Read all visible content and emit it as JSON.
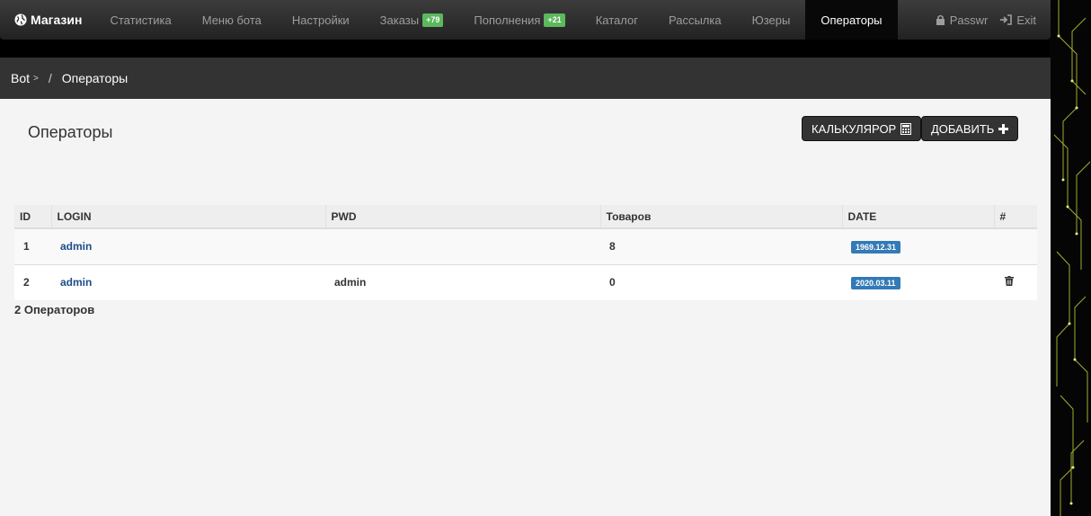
{
  "brand": "Магазин",
  "nav": {
    "items": [
      {
        "label": "Статистика"
      },
      {
        "label": "Меню бота"
      },
      {
        "label": "Настройки"
      },
      {
        "label": "Заказы",
        "badge": "+79"
      },
      {
        "label": "Пополнения",
        "badge": "+21"
      },
      {
        "label": "Каталог"
      },
      {
        "label": "Рассылка"
      },
      {
        "label": "Юзеры"
      },
      {
        "label": "Операторы",
        "active": true
      }
    ],
    "passwr": "Passwr",
    "exit": "Exit"
  },
  "breadcrumb": {
    "root": "Bot",
    "root_sep": ">",
    "slash": "/",
    "current": "Операторы"
  },
  "page": {
    "title": "Операторы",
    "calc_button": "КАЛЬКУЛЯРОР",
    "add_button": "ДОБАВИТЬ"
  },
  "table": {
    "headers": [
      "ID",
      "LOGIN",
      "PWD",
      "Товаров",
      "DATE",
      "#"
    ],
    "rows": [
      {
        "id": "1",
        "login": "admin",
        "pwd": "",
        "items": "8",
        "date": "1969.12.31",
        "deletable": false
      },
      {
        "id": "2",
        "login": "admin",
        "pwd": "admin",
        "items": "0",
        "date": "2020.03.11",
        "deletable": true
      }
    ]
  },
  "footer_count": "2 Операторов",
  "colors": {
    "badge_green": "#5cb85c",
    "badge_blue": "#337ab7",
    "link": "#1e4c8a",
    "navbar": "#222222"
  }
}
